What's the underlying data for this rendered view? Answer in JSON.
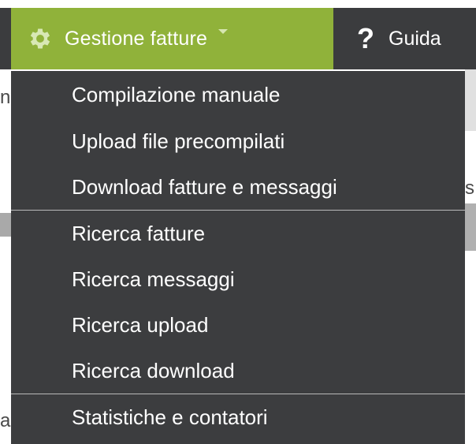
{
  "nav": {
    "main_label": "Gestione fatture",
    "main_icon": "gear-icon",
    "help_label": "Guida",
    "help_icon": "question-mark-icon",
    "accent_color": "#90b23a",
    "dark_color": "#3b3c3e"
  },
  "menu": {
    "groups": [
      [
        "Compilazione manuale",
        "Upload file precompilati",
        "Download fatture e messaggi"
      ],
      [
        "Ricerca fatture",
        "Ricerca messaggi",
        "Ricerca upload",
        "Ricerca download"
      ],
      [
        "Statistiche e contatori"
      ]
    ]
  },
  "background": {
    "fragments": [
      "n",
      "s",
      "a"
    ]
  }
}
